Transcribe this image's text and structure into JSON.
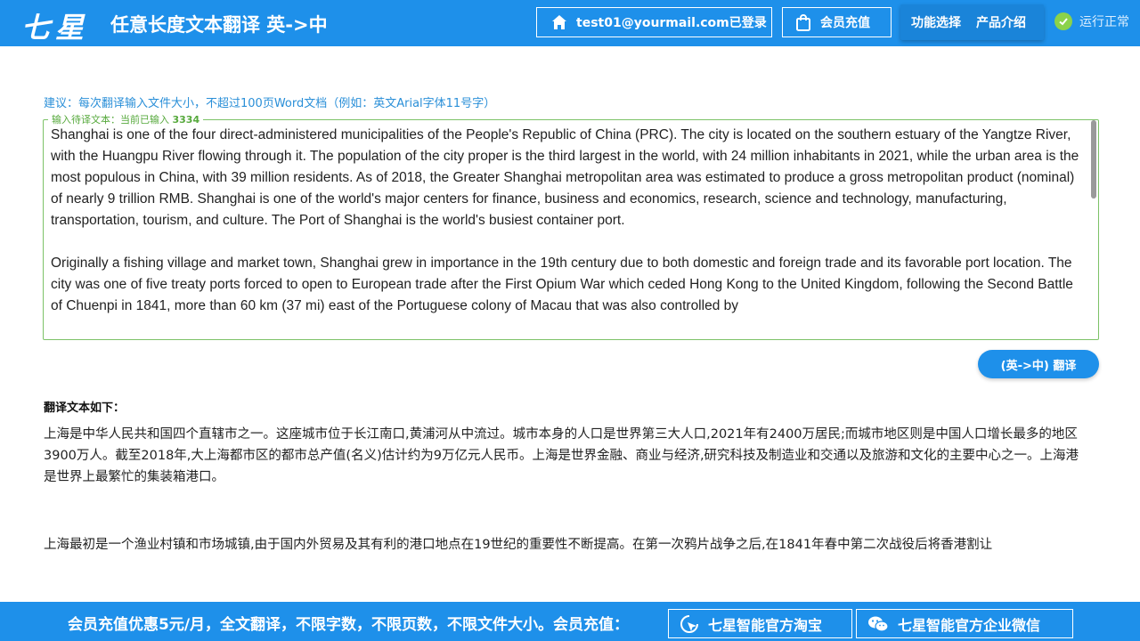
{
  "header": {
    "logo_text": "七星",
    "title": "任意长度文本翻译 英->中",
    "user_label": "test01@yourmail.com已登录",
    "recharge_label": "会员充值",
    "menu": [
      "功能选择",
      "产品介绍"
    ],
    "status_label": "运行正常"
  },
  "main": {
    "tip": "建议：每次翻译输入文件大小，不超过100页Word文档（例如：英文Arial字体11号字）",
    "input_legend_prefix": "输入待译文本：当前已输入",
    "input_count": "3334",
    "source_paragraphs": [
      "Shanghai is one of the four direct-administered municipalities of the People's Republic of China (PRC). The city is located on the southern estuary of the Yangtze River, with the Huangpu River flowing through it. The population of the city proper is the third largest in the world, with 24 million inhabitants in 2021, while the urban area is the most populous in China, with 39 million residents. As of 2018, the Greater Shanghai metropolitan area was estimated to produce a gross metropolitan product (nominal) of nearly 9 trillion RMB. Shanghai is one of the world's major centers for finance, business and economics, research, science and technology, manufacturing, transportation, tourism, and culture. The Port of Shanghai is the world's busiest container port.",
      "Originally a fishing village and market town, Shanghai grew in importance in the 19th century due to both domestic and foreign trade and its favorable port location. The city was one of five treaty ports forced to open to European trade after the First Opium War which ceded Hong Kong to the United Kingdom, following the Second Battle of Chuenpi in 1841, more than 60 km (37 mi) east of the Portuguese colony of Macau that was also controlled by"
    ],
    "translate_button": "(英->中) 翻译",
    "output_label": "翻译文本如下：",
    "output_paragraphs": [
      "上海是中华人民共和国四个直辖市之一。这座城市位于长江南口,黄浦河从中流过。城市本身的人口是世界第三大人口,2021年有2400万居民;而城市地区则是中国人口增长最多的地区3900万人。截至2018年,大上海都市区的都市总产值(名义)估计约为9万亿元人民币。上海是世界金融、商业与经济,研究科技及制造业和交通以及旅游和文化的主要中心之一。上海港是世界上最繁忙的集装箱港口。",
      "上海最初是一个渔业村镇和市场城镇,由于国内外贸易及其有利的港口地点在19世纪的重要性不断提高。在第一次鸦片战争之后,在1841年春中第二次战役后将香港割让"
    ]
  },
  "footer": {
    "promo": "会员充值优惠5元/月，全文翻译，不限字数，不限页数，不限文件大小。会员充值：",
    "taobao_label": "七星智能官方淘宝",
    "wechat_label": "七星智能官方企业微信"
  }
}
